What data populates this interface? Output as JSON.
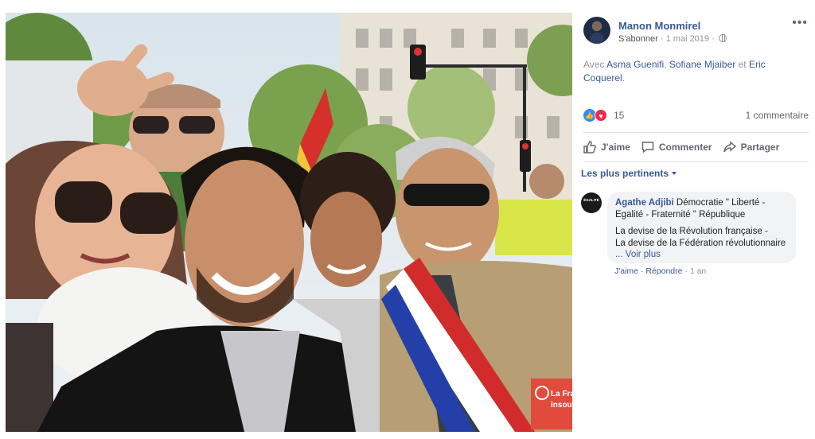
{
  "post": {
    "author": "Manon Monmirel",
    "subscribe": "S'abonner",
    "date": "1 mai 2019",
    "with_prefix": "Avec",
    "tagged_1": "Asma Guenifi",
    "separator": ",",
    "tagged_2": "Sofiane Mjaiber",
    "conjunction": "et",
    "tagged_3": "Eric Coquerel",
    "period": "."
  },
  "photo": {
    "banner_text_1": "La Fra",
    "banner_text_2": "insoum"
  },
  "reactions": {
    "count": "15",
    "comments": "1 commentaire"
  },
  "actions": {
    "like": "J'aime",
    "comment": "Commenter",
    "share": "Partager"
  },
  "comments_section": {
    "sort_label": "Les plus pertinents",
    "comment": {
      "avatar_text": "ÉGALITÉ",
      "author": "Agathe Adjibi",
      "line_1": "Démocratie \" Liberté -",
      "line_2": "Egalité - Fraternité \" République",
      "body_1": "La devise de la Révolution française -",
      "body_2": "La devise de la Fédération révolutionnaire",
      "see_more": "... Voir plus",
      "like": "J'aime",
      "dot": "·",
      "reply": "Répondre",
      "time": "1 an"
    }
  },
  "colors": {
    "link": "#385898",
    "like": "#2e89ff",
    "love": "#f0284a",
    "muted": "#90949c"
  }
}
